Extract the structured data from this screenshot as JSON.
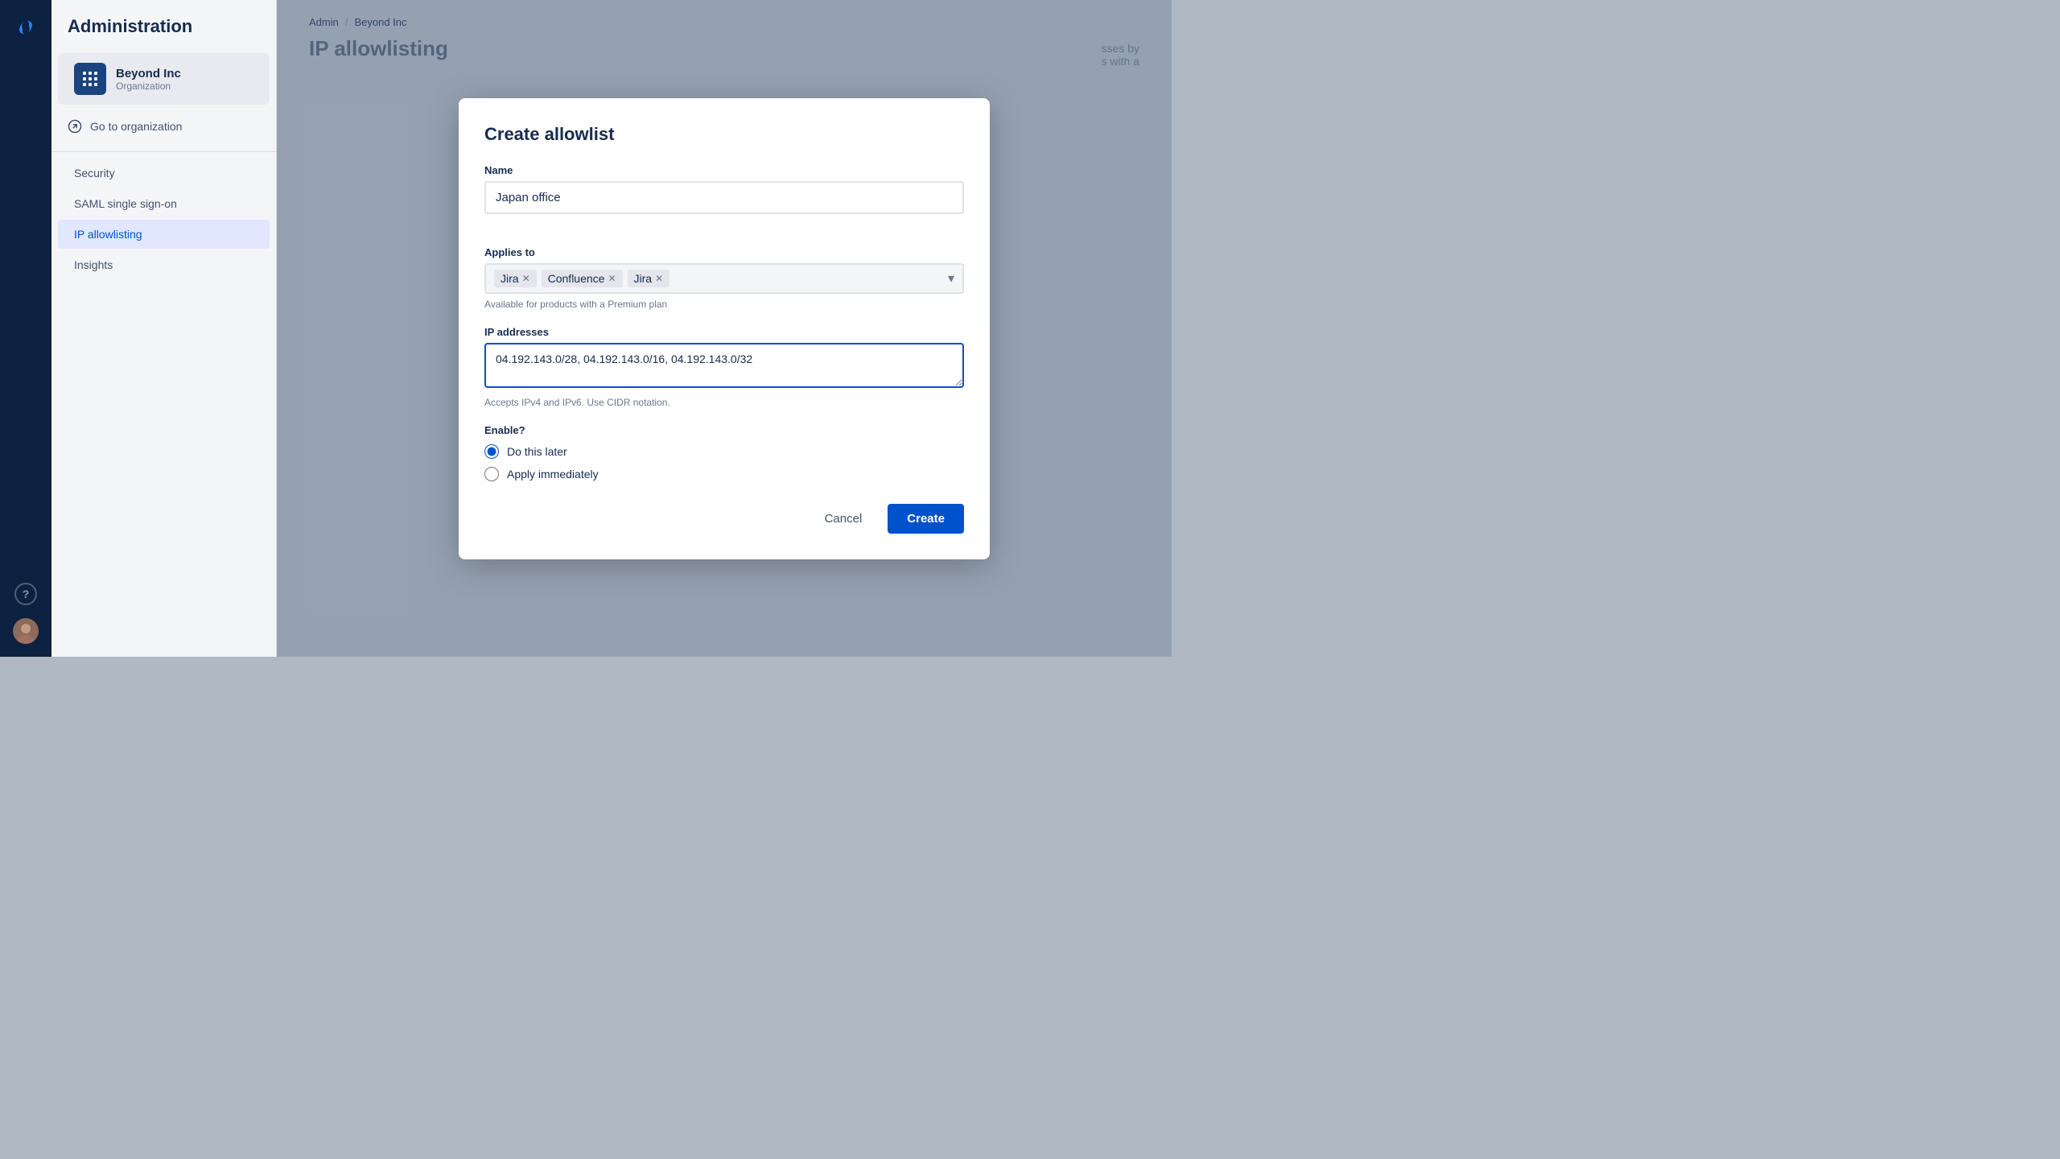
{
  "sidebar": {
    "admin_title": "Administration",
    "org": {
      "name": "Beyond Inc",
      "type": "Organization"
    },
    "go_to_org": "Go to organization",
    "nav_items": [
      {
        "id": "security",
        "label": "Security",
        "active": false
      },
      {
        "id": "saml",
        "label": "SAML single sign-on",
        "active": false
      },
      {
        "id": "ip-allowlisting",
        "label": "IP allowlisting",
        "active": true
      },
      {
        "id": "insights",
        "label": "Insights",
        "active": false
      }
    ]
  },
  "breadcrumb": {
    "admin": "Admin",
    "separator": "/",
    "org": "Beyond Inc"
  },
  "page_title": "IP allowlisting",
  "bg_text_1": "sses by",
  "bg_text_2": "s with a",
  "modal": {
    "title": "Create allowlist",
    "name_label": "Name",
    "name_value": "Japan office",
    "applies_to_label": "Applies to",
    "tags": [
      {
        "id": "jira1",
        "label": "Jira"
      },
      {
        "id": "confluence",
        "label": "Confluence"
      },
      {
        "id": "jira2",
        "label": "Jira"
      }
    ],
    "premium_note": "Available for products with a Premium plan",
    "ip_label": "IP addresses",
    "ip_value": "04.192.143.0/28, 04.192.143.0/16, 04.192.143.0/32",
    "ip_hint": "Accepts IPv4 and IPv6. Use CIDR notation.",
    "enable_label": "Enable?",
    "radio_options": [
      {
        "id": "later",
        "label": "Do this later",
        "checked": true
      },
      {
        "id": "immediately",
        "label": "Apply immediately",
        "checked": false
      }
    ],
    "cancel_label": "Cancel",
    "create_label": "Create"
  }
}
